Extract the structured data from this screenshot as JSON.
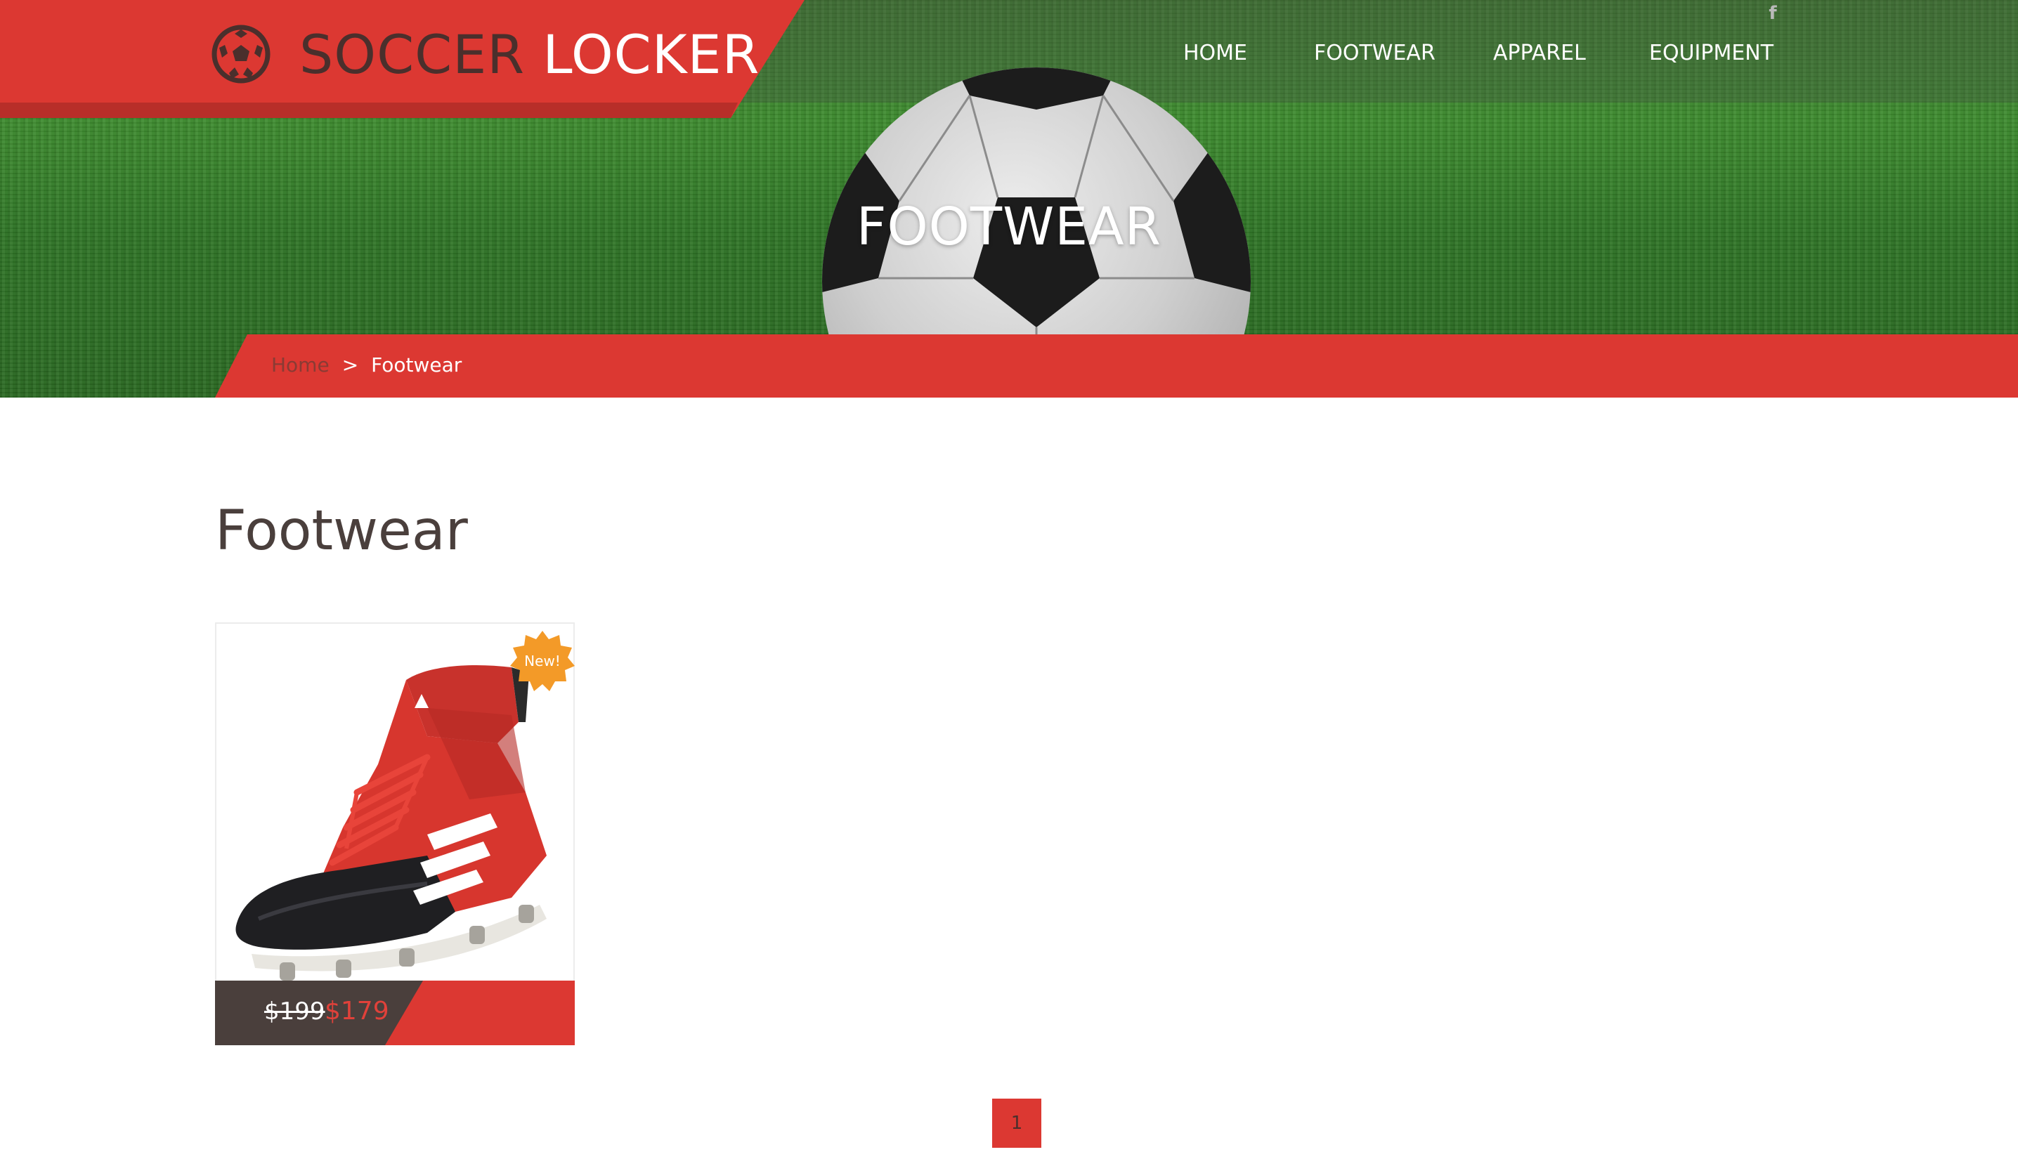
{
  "brand": {
    "logo_word1": "SOCCER",
    "logo_word2": "LOCKER",
    "logo_icon": "soccer-ball-icon",
    "accent_color": "#dc3832",
    "dark_color": "#4a3f3c"
  },
  "nav": {
    "items": [
      {
        "label": "HOME"
      },
      {
        "label": "FOOTWEAR"
      },
      {
        "label": "APPAREL"
      },
      {
        "label": "EQUIPMENT"
      }
    ],
    "social_icon": "facebook-icon"
  },
  "hero": {
    "title": "FOOTWEAR"
  },
  "breadcrumb": {
    "home": "Home",
    "separator": ">",
    "current": "Footwear"
  },
  "main": {
    "heading": "Footwear",
    "products": [
      {
        "image_icon": "soccer-cleat-image",
        "badge": "New!",
        "old_price": "$199",
        "price": "$179"
      }
    ],
    "pagination": {
      "current_page": "1"
    }
  }
}
